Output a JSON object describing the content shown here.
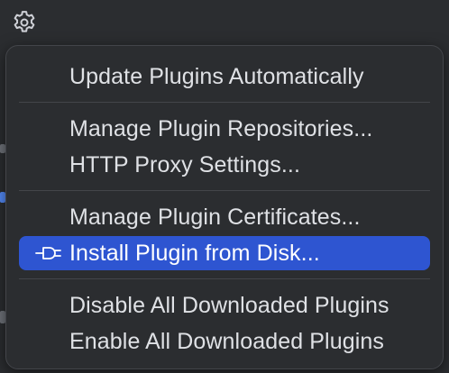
{
  "toolbar": {
    "settings_icon": "gear-icon"
  },
  "menu": {
    "items": [
      {
        "label": "Update Plugins Automatically"
      },
      {
        "label": "Manage Plugin Repositories..."
      },
      {
        "label": "HTTP Proxy Settings..."
      },
      {
        "label": "Manage Plugin Certificates..."
      },
      {
        "label": "Install Plugin from Disk...",
        "icon": "plug-icon",
        "selected": true
      },
      {
        "label": "Disable All Downloaded Plugins"
      },
      {
        "label": "Enable All Downloaded Plugins"
      }
    ]
  },
  "colors": {
    "background": "#2b2d30",
    "menu_border": "#43454a",
    "text": "#dfe1e5",
    "selection": "#2e55d1",
    "selected_text": "#ffffff"
  }
}
